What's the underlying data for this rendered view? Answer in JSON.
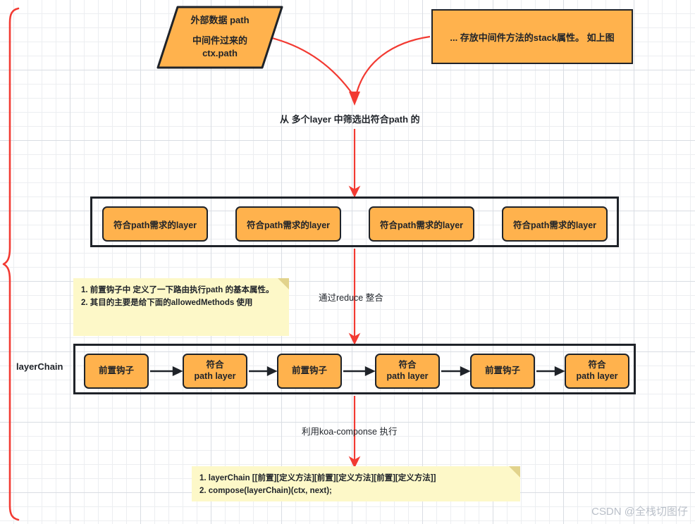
{
  "diagram": {
    "title": "koa-router layerChain flow",
    "colors": {
      "node_orange": "#FFB24D",
      "node_border": "#1f2329",
      "note_yellow": "#FDF8C8",
      "note_fold": "#E2D38C",
      "arrow_red": "#F23A32",
      "arrow_black": "#1f2329",
      "grid_line": "#eceef1",
      "grid_major": "#d9dde3"
    },
    "source_node": {
      "shape": "parallelogram",
      "line1": "外部数据 path",
      "line2": "中间件过来的",
      "line3": "ctx.path"
    },
    "stack_node": {
      "shape": "rectangle",
      "text": "... 存放中间件方法的stack属性。 如上图"
    },
    "labels": {
      "filter": "从 多个layer 中筛选出符合path 的",
      "reduce": "通过reduce 整合",
      "compose": "利用koa-componse 执行"
    },
    "layers_group": {
      "items": [
        {
          "label": "符合path需求的layer"
        },
        {
          "label": "符合path需求的layer"
        },
        {
          "label": "符合path需求的layer"
        },
        {
          "label": "符合path需求的layer"
        }
      ]
    },
    "hooks_note": {
      "line1": "1. 前置钩子中 定义了一下路由执行path 的基本属性。",
      "line2": "2. 其目的主要是给下面的allowedMethods 使用"
    },
    "chain": {
      "label": "layerChain",
      "items": [
        {
          "line1": "前置钩子",
          "line2": ""
        },
        {
          "line1": "符合",
          "line2": "path layer"
        },
        {
          "line1": "前置钩子",
          "line2": ""
        },
        {
          "line1": "符合",
          "line2": "path layer"
        },
        {
          "line1": "前置钩子",
          "line2": ""
        },
        {
          "line1": "符合",
          "line2": "path layer"
        }
      ]
    },
    "compose_note": {
      "line1": "1. layerChain [[前置][定义方法][前置][定义方法][前置][定义方法]]",
      "line2": "2. compose(layerChain)(ctx, next);"
    },
    "watermark": "CSDN @全栈切图仔"
  }
}
